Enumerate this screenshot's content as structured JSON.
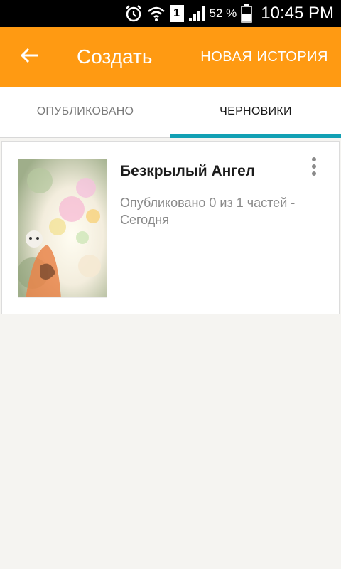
{
  "status_bar": {
    "sim_number": "1",
    "battery_percent": "52 %",
    "time": "10:45 PM",
    "icons": [
      "alarm-icon",
      "wifi-icon",
      "sim-icon",
      "signal-icon",
      "battery-icon"
    ]
  },
  "toolbar": {
    "back_icon": "arrow-left-icon",
    "title": "Создать",
    "action_label": "НОВАЯ ИСТОРИЯ",
    "color": "#ff9a12"
  },
  "tabs": [
    {
      "label": "ОПУБЛИКОВАНО",
      "active": false
    },
    {
      "label": "ЧЕРНОВИКИ",
      "active": true
    }
  ],
  "tab_indicator_color": "#12a0b4",
  "stories": [
    {
      "title": "Безкрылый Ангел",
      "status": "Опубликовано 0 из 1 частей - Сегодня",
      "menu_icon": "more-vert-icon"
    }
  ]
}
